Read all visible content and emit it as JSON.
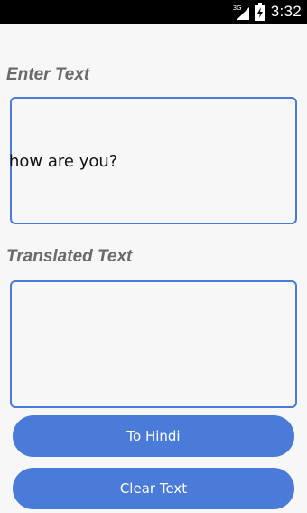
{
  "status_bar": {
    "network": "3G",
    "time": "3:32",
    "icons": [
      "signal-icon",
      "battery-charging-icon"
    ]
  },
  "labels": {
    "enter_text": "Enter Text",
    "translated_text": "Translated Text"
  },
  "input": {
    "value": "how are you?"
  },
  "output": {
    "value": ""
  },
  "buttons": {
    "to_hindi": "To Hindi",
    "clear_text": "Clear Text"
  },
  "colors": {
    "accent": "#4a7bd8",
    "label": "#6a6a6a",
    "background": "#f7f7f7",
    "status_bar": "#000000"
  }
}
